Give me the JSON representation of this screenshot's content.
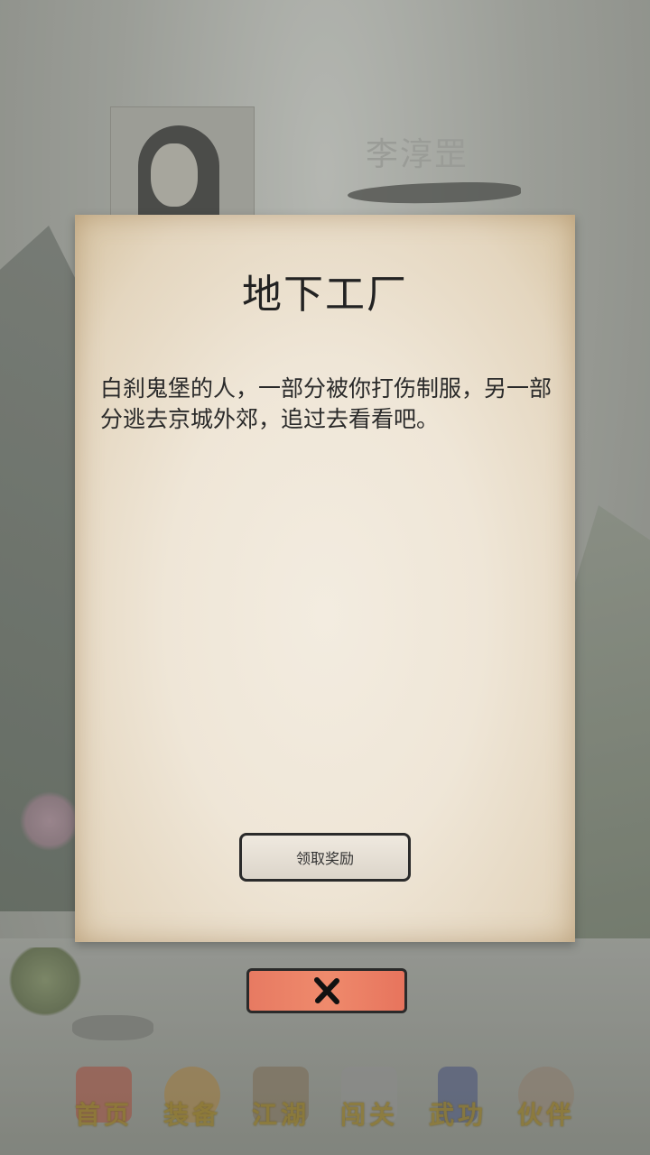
{
  "hero": {
    "name": "李淳罡"
  },
  "dialog": {
    "title": "地下工厂",
    "body": "白刹鬼堡的人，一部分被你打伤制服，另一部分逃去京城外郊，追过去看看吧。",
    "claim_label": "领取奖励"
  },
  "close_button": {
    "icon": "close-x-icon"
  },
  "bottom_nav": {
    "items": [
      {
        "label": "首页",
        "icon": "home-gate-icon",
        "color": "#a34a3a"
      },
      {
        "label": "装备",
        "icon": "armor-icon",
        "color": "#a07a3a"
      },
      {
        "label": "江湖",
        "icon": "world-map-icon",
        "color": "#7a6a52"
      },
      {
        "label": "闯关",
        "icon": "crossed-swords-icon",
        "color": "#8a8a8a"
      },
      {
        "label": "武功",
        "icon": "martial-scroll-icon",
        "color": "#45507a"
      },
      {
        "label": "伙伴",
        "icon": "companions-icon",
        "color": "#8a7a6a"
      }
    ]
  }
}
